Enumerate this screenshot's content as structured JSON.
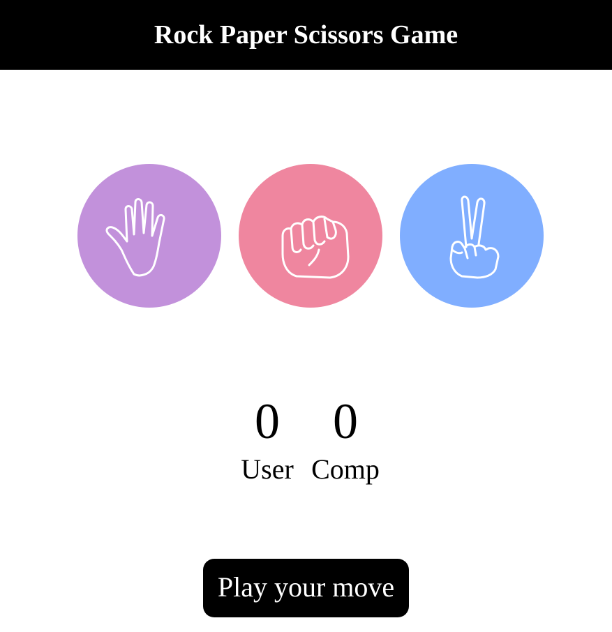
{
  "header": {
    "title": "Rock Paper Scissors Game"
  },
  "choices": [
    {
      "id": "paper",
      "icon": "open-hand-icon",
      "color": "#c291db"
    },
    {
      "id": "rock",
      "icon": "fist-icon",
      "color": "#ef869f"
    },
    {
      "id": "scissors",
      "icon": "peace-hand-icon",
      "color": "#80aeff"
    }
  ],
  "scores": {
    "user": {
      "value": "0",
      "label": "User"
    },
    "comp": {
      "value": "0",
      "label": "Comp"
    }
  },
  "message": {
    "text": "Play your move",
    "bg_color": "#000000"
  }
}
